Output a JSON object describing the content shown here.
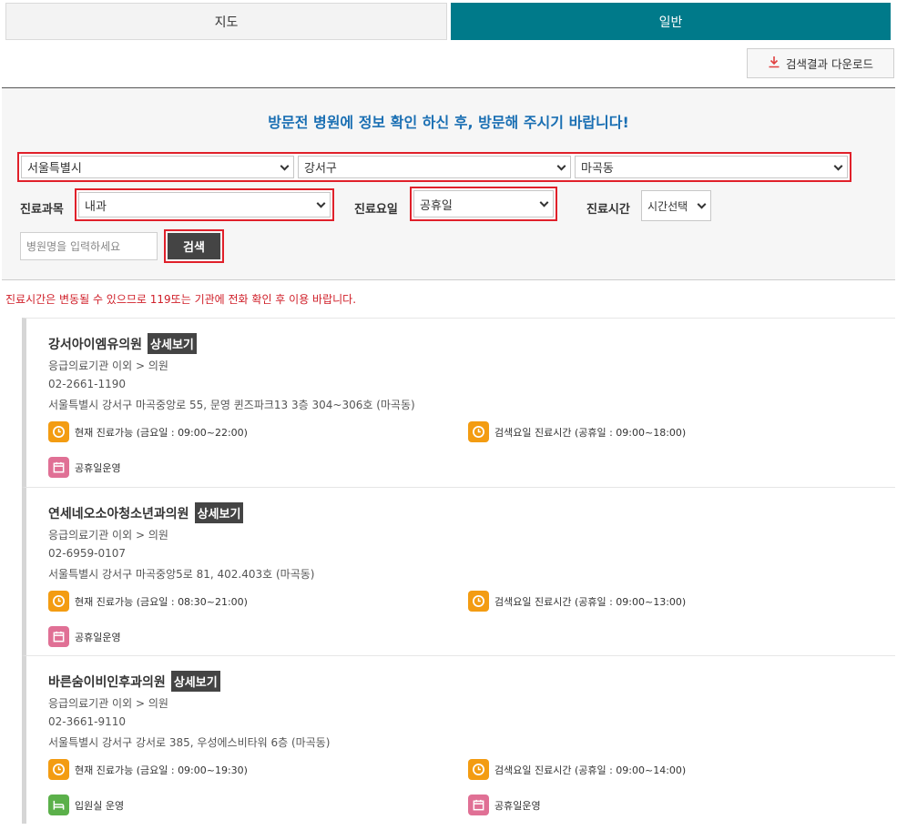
{
  "tabs": [
    {
      "label": "지도",
      "active": false
    },
    {
      "label": "일반",
      "active": true
    }
  ],
  "download_label": "검색결과 다운로드",
  "notice_title": "방문전 병원에 정보 확인 하신 후, 방문해 주시기 바랍니다!",
  "filters": {
    "region": {
      "sido": "서울특별시",
      "sigungu": "강서구",
      "dong": "마곡동"
    },
    "dept_label": "진료과목",
    "dept_value": "내과",
    "day_label": "진료요일",
    "day_value": "공휴일",
    "time_label": "진료시간",
    "time_value": "시간선택",
    "name_placeholder": "병원명을 입력하세요",
    "search_label": "검색"
  },
  "warning": "진료시간은 변동될 수 있으므로 119또는 기관에 전화 확인 후 이용 바랍니다.",
  "detail_label": "상세보기",
  "results": [
    {
      "name": "강서아이엠유의원",
      "category": "응급의료기관 이외 > 의원",
      "phone": "02-2661-1190",
      "address": "서울특별시 강서구 마곡중앙로 55, 문영 퀸즈파크13 3층 304~306호 (마곡동)",
      "now_hours": "현재 진료가능 (금요일 : 09:00~22:00)",
      "search_hours": "검색요일 진료시간 (공휴일 : 09:00~18:00)",
      "badges": [
        {
          "label": "공휴일운영",
          "icon": "calendar-icon"
        }
      ]
    },
    {
      "name": "연세네오소아청소년과의원",
      "category": "응급의료기관 이외 > 의원",
      "phone": "02-6959-0107",
      "address": "서울특별시 강서구 마곡중앙5로 81, 402.403호 (마곡동)",
      "now_hours": "현재 진료가능 (금요일 : 08:30~21:00)",
      "search_hours": "검색요일 진료시간 (공휴일 : 09:00~13:00)",
      "badges": [
        {
          "label": "공휴일운영",
          "icon": "calendar-icon"
        }
      ]
    },
    {
      "name": "바른숨이비인후과의원",
      "category": "응급의료기관 이외 > 의원",
      "phone": "02-3661-9110",
      "address": "서울특별시 강서구 강서로 385, 우성에스비타워 6층 (마곡동)",
      "now_hours": "현재 진료가능 (금요일 : 09:00~19:30)",
      "search_hours": "검색요일 진료시간 (공휴일 : 09:00~14:00)",
      "badges": [
        {
          "label": "입원실 운영",
          "icon": "bed-icon"
        },
        {
          "label": "공휴일운영",
          "icon": "calendar-icon"
        }
      ]
    }
  ],
  "colors": {
    "accent": "#007a8a",
    "notice": "#1a6fb3",
    "highlight": "#e0202a",
    "clock": "#f39c12",
    "calendar": "#e07095",
    "bed": "#5bb04a"
  }
}
